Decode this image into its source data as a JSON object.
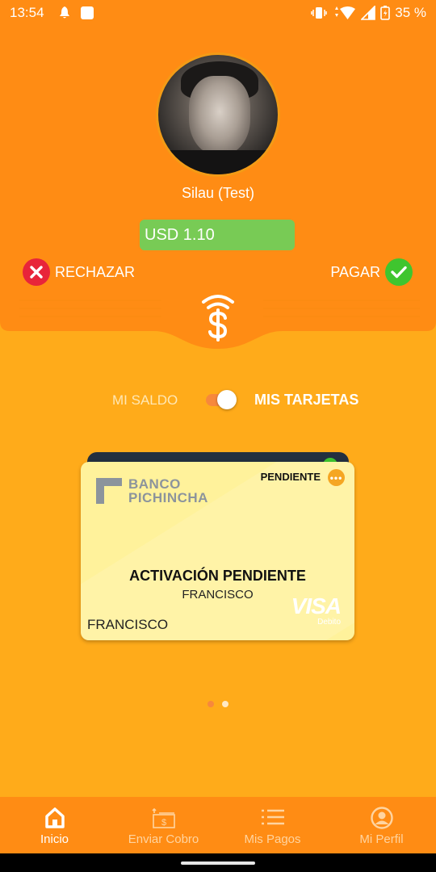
{
  "status_bar": {
    "time": "13:54",
    "battery": "35 %",
    "icons": [
      "bell-icon",
      "app-square-icon",
      "vibrate-icon",
      "wifi-icon",
      "signal-icon",
      "battery-icon"
    ]
  },
  "payer": {
    "name": "Silau (Test)",
    "amount": "USD 1.10"
  },
  "actions": {
    "reject_label": "RECHAZAR",
    "pay_label": "PAGAR"
  },
  "toggle": {
    "left_label": "MI SALDO",
    "right_label": "MIS TARJETAS",
    "on": true
  },
  "card": {
    "bank_line1": "BANCO",
    "bank_line2": "PICHINCHA",
    "status": "PENDIENTE",
    "title": "ACTIVACIÓN PENDIENTE",
    "subtitle": "FRANCISCO",
    "holder": "FRANCISCO",
    "network": "VISA",
    "network_sub": "Debito"
  },
  "pager": {
    "pages": 2,
    "current": 1
  },
  "nav": {
    "items": [
      {
        "label": "Inicio",
        "icon": "home-icon",
        "active": true
      },
      {
        "label": "Enviar Cobro",
        "icon": "send-charge-icon",
        "active": false
      },
      {
        "label": "Mis Pagos",
        "icon": "list-icon",
        "active": false
      },
      {
        "label": "Mi Perfil",
        "icon": "profile-icon",
        "active": false
      }
    ]
  },
  "colors": {
    "header": "#FF8C14",
    "background": "#FFAB1A",
    "amount_pill": "#78CB55",
    "reject": "#E8253A",
    "pay": "#3FC52F",
    "card": "#FFF29B"
  }
}
